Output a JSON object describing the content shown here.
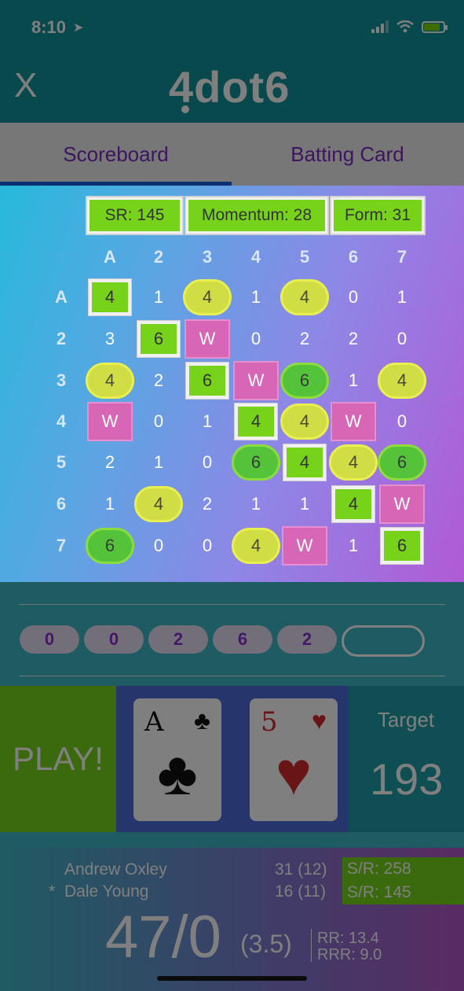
{
  "status_bar": {
    "time": "8:10"
  },
  "header": {
    "close_label": "X",
    "logo_text": "4dot6"
  },
  "tabs": [
    {
      "label": "Scoreboard"
    },
    {
      "label": "Batting Card"
    }
  ],
  "stats": {
    "sr": "SR: 145",
    "momentum": "Momentum: 28",
    "form": "Form: 31"
  },
  "grid": {
    "columns": [
      "A",
      "2",
      "3",
      "4",
      "5",
      "6",
      "7"
    ],
    "rows": [
      {
        "label": "A",
        "cells": [
          "4",
          "1",
          "4",
          "1",
          "4",
          "0",
          "1"
        ]
      },
      {
        "label": "2",
        "cells": [
          "3",
          "6",
          "W",
          "0",
          "2",
          "2",
          "0"
        ]
      },
      {
        "label": "3",
        "cells": [
          "4",
          "2",
          "6",
          "W",
          "6",
          "1",
          "4"
        ]
      },
      {
        "label": "4",
        "cells": [
          "W",
          "0",
          "1",
          "4",
          "4",
          "W",
          "0"
        ]
      },
      {
        "label": "5",
        "cells": [
          "2",
          "1",
          "0",
          "6",
          "4",
          "4",
          "6"
        ]
      },
      {
        "label": "6",
        "cells": [
          "1",
          "4",
          "2",
          "1",
          "1",
          "4",
          "W"
        ]
      },
      {
        "label": "7",
        "cells": [
          "6",
          "0",
          "0",
          "4",
          "W",
          "1",
          "6"
        ]
      }
    ],
    "marks": [
      [
        "green-box",
        "",
        "yellow",
        "",
        "yellow",
        "",
        ""
      ],
      [
        "",
        "green-box",
        "pink",
        "",
        "",
        "",
        ""
      ],
      [
        "yellow",
        "",
        "green-box",
        "pink",
        "green-oval",
        "",
        "yellow"
      ],
      [
        "pink",
        "",
        "",
        "green-box",
        "yellow",
        "pink",
        ""
      ],
      [
        "",
        "",
        "",
        "green-oval",
        "green-box",
        "yellow",
        "green-oval"
      ],
      [
        "",
        "yellow",
        "",
        "",
        "",
        "green-box",
        "pink"
      ],
      [
        "green-oval",
        "",
        "",
        "yellow",
        "pink",
        "",
        "green-box"
      ]
    ]
  },
  "over_balls": [
    "0",
    "0",
    "2",
    "6",
    "2",
    ""
  ],
  "play_button": "PLAY!",
  "cards": [
    {
      "rank": "A",
      "suit_icon": "club-icon",
      "suit": "♣",
      "color": "black"
    },
    {
      "rank": "5",
      "suit_icon": "heart-icon",
      "suit": "♥",
      "color": "red"
    }
  ],
  "target": {
    "label": "Target",
    "value": "193"
  },
  "batters": [
    {
      "star": "",
      "name": "Andrew Oxley",
      "runs": "31 (12)",
      "sr": "S/R: 258"
    },
    {
      "star": "*",
      "name": "Dale Young",
      "runs": "16 (11)",
      "sr": "S/R: 145"
    }
  ],
  "score": {
    "total": "47/0",
    "overs": "(3.5)",
    "rr": "RR: 13.4",
    "rrr": "RRR: 9.0"
  },
  "colors": {
    "accent_green": "#77d31a",
    "purple": "#8b2ed2",
    "teal": "#11939c",
    "pink": "#d766b6",
    "yellow": "#d1dd45"
  }
}
